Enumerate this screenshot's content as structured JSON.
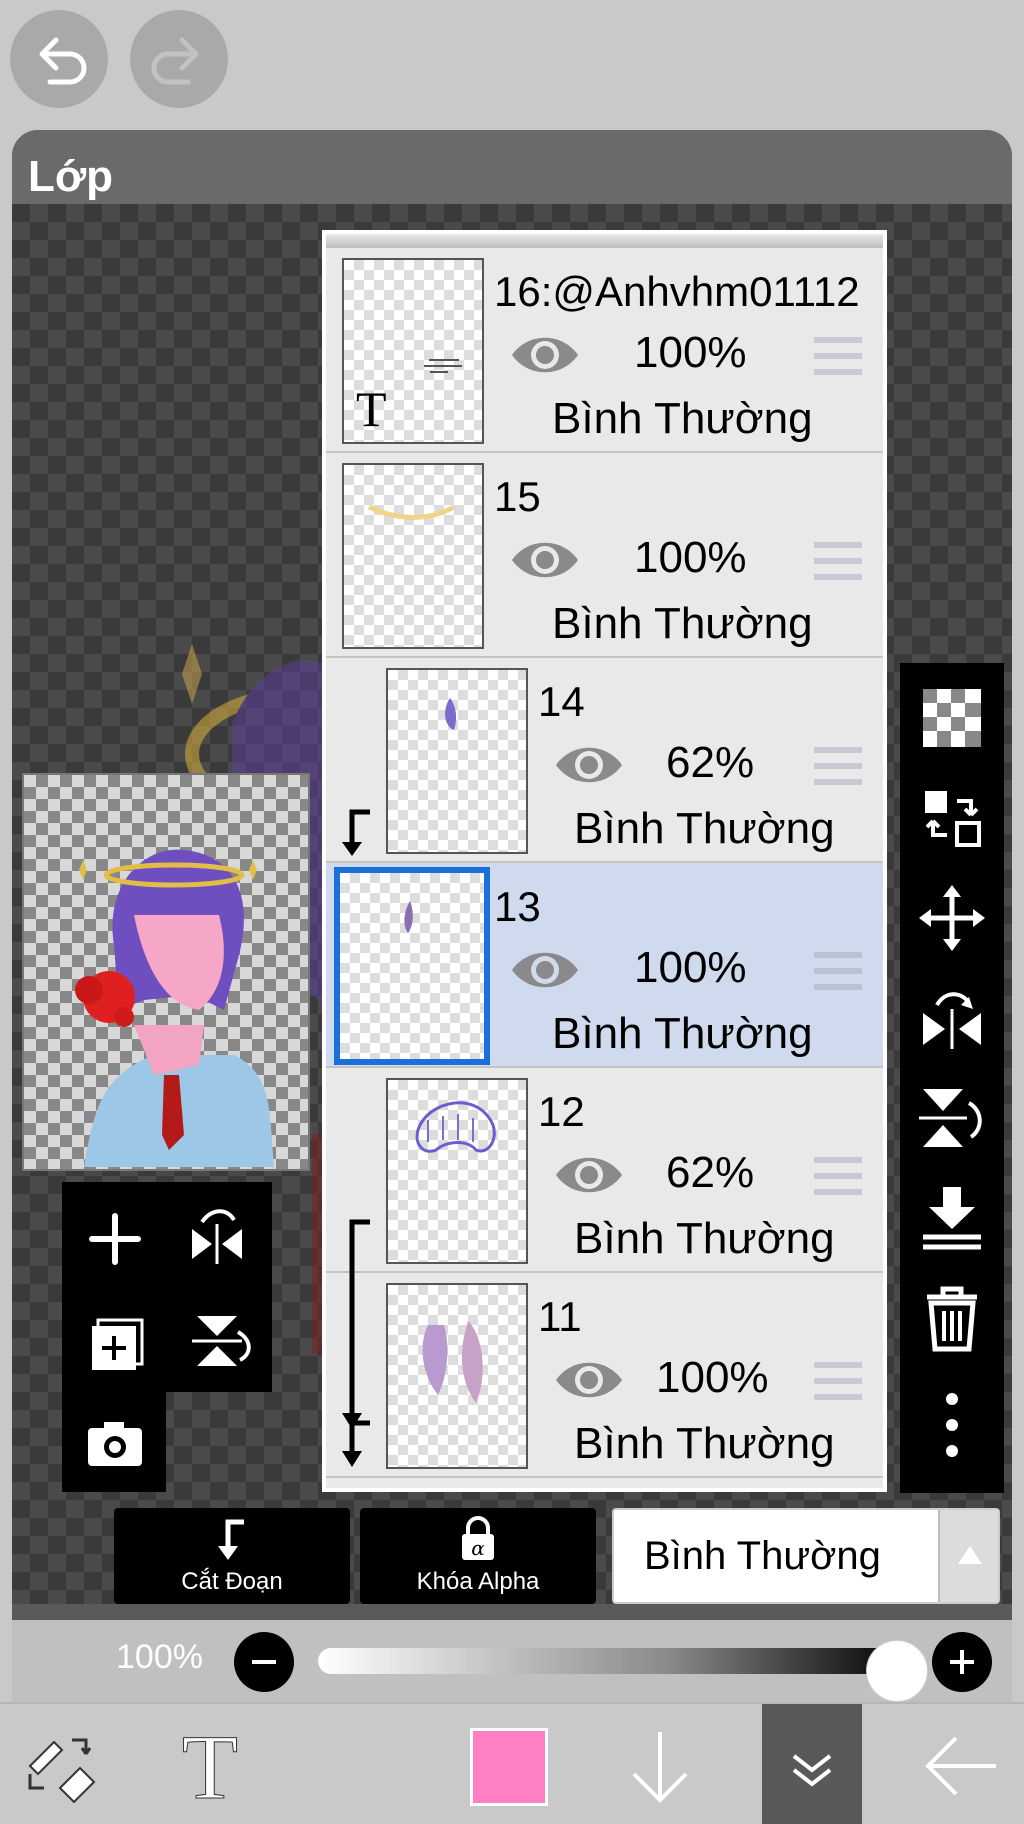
{
  "panel": {
    "title": "Lớp"
  },
  "layers": [
    {
      "name": "16:@Anhvhm01112",
      "opacity": "100%",
      "mode": "Bình Thường",
      "selected": false,
      "clipped": false,
      "text_layer": true
    },
    {
      "name": "15",
      "opacity": "100%",
      "mode": "Bình Thường",
      "selected": false,
      "clipped": false,
      "text_layer": false
    },
    {
      "name": "14",
      "opacity": "62%",
      "mode": "Bình Thường",
      "selected": false,
      "clipped": true,
      "text_layer": false
    },
    {
      "name": "13",
      "opacity": "100%",
      "mode": "Bình Thường",
      "selected": true,
      "clipped": false,
      "text_layer": false
    },
    {
      "name": "12",
      "opacity": "62%",
      "mode": "Bình Thường",
      "selected": false,
      "clipped": true,
      "text_layer": false
    },
    {
      "name": "11",
      "opacity": "100%",
      "mode": "Bình Thường",
      "selected": false,
      "clipped": true,
      "text_layer": false
    }
  ],
  "bottom": {
    "clip_label": "Cắt Đoạn",
    "alpha_lock_label": "Khóa Alpha",
    "blend_mode": "Bình Thường"
  },
  "opacity_bar": {
    "value_label": "100%",
    "value": 1.0
  },
  "toolbar": {
    "text_tool_glyph": "T",
    "current_color": "#ff7fc3"
  },
  "icons": [
    "undo-icon",
    "redo-icon",
    "add-layer-icon",
    "duplicate-layer-icon",
    "camera-icon",
    "flip-horizontal-icon",
    "flip-vertical-icon",
    "transparency-icon",
    "layer-swap-icon",
    "move-icon",
    "merge-down-icon",
    "delete-icon",
    "more-icon",
    "eye-icon",
    "drag-handle-icon",
    "clip-icon",
    "alpha-lock-icon",
    "brush-eraser-swap-icon",
    "arrow-down-icon",
    "double-chevron-down-icon",
    "back-arrow-icon"
  ],
  "colors": {
    "accent": "#1c6fd8",
    "selected_row": "#cfdaee",
    "brush": "#ff7fc3"
  }
}
